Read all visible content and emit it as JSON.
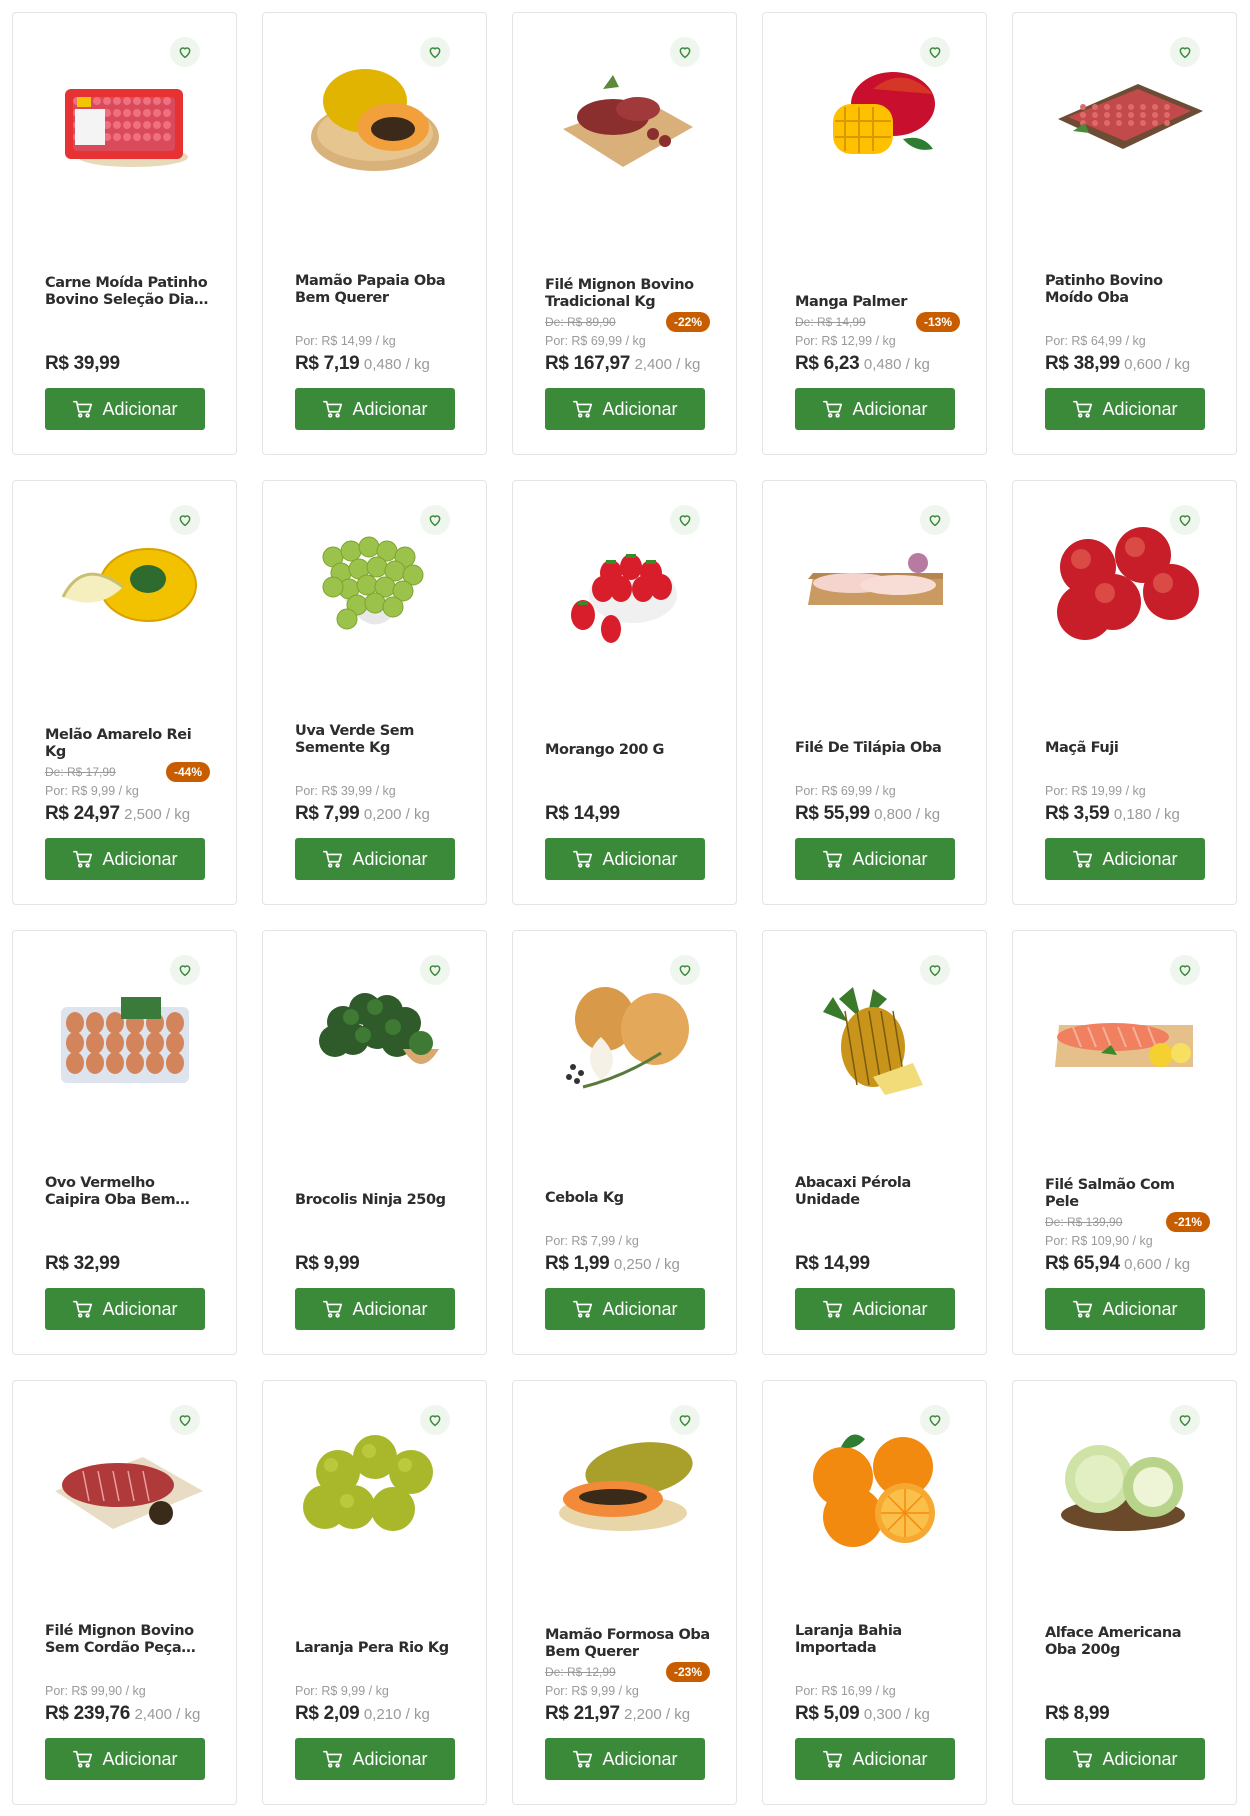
{
  "colors": {
    "button": "#3b8a3a",
    "badge": "#c85d00",
    "fav_bg": "#eef6ee",
    "heart": "#3b8a3a"
  },
  "add_label": "Adicionar",
  "products": [
    {
      "name": "Carne Moída Patinho Bovino Seleção Dia A...",
      "old": "",
      "badge": "",
      "por": "",
      "price": "R$ 39,99",
      "unit": "",
      "img": "ground-beef-tray-image"
    },
    {
      "name": "Mamão Papaia Oba Bem Querer",
      "old": "",
      "badge": "",
      "por": "Por: R$ 14,99 / kg",
      "price": "R$ 7,19",
      "unit": "0,480 / kg",
      "img": "papaya-image"
    },
    {
      "name": "Filé Mignon Bovino Tradicional Kg",
      "old": "De: R$ 89,90",
      "badge": "-22%",
      "por": "Por: R$ 69,99 / kg",
      "price": "R$ 167,97",
      "unit": "2,400 / kg",
      "img": "filet-mignon-image"
    },
    {
      "name": "Manga Palmer",
      "old": "De: R$ 14,99",
      "badge": "-13%",
      "por": "Por: R$ 12,99 / kg",
      "price": "R$ 6,23",
      "unit": "0,480 / kg",
      "img": "mango-image"
    },
    {
      "name": "Patinho Bovino Moído Oba",
      "old": "",
      "badge": "",
      "por": "Por: R$ 64,99 / kg",
      "price": "R$ 38,99",
      "unit": "0,600 / kg",
      "img": "ground-beef-board-image"
    },
    {
      "name": "Melão Amarelo Rei Kg",
      "old": "De: R$ 17,99",
      "badge": "-44%",
      "por": "Por: R$ 9,99 / kg",
      "price": "R$ 24,97",
      "unit": "2,500 / kg",
      "img": "melon-image"
    },
    {
      "name": "Uva Verde Sem Semente Kg",
      "old": "",
      "badge": "",
      "por": "Por: R$ 39,99 / kg",
      "price": "R$ 7,99",
      "unit": "0,200 / kg",
      "img": "green-grapes-image"
    },
    {
      "name": "Morango 200 G",
      "old": "",
      "badge": "",
      "por": "",
      "price": "R$ 14,99",
      "unit": "",
      "img": "strawberries-image"
    },
    {
      "name": "Filé De Tilápia Oba",
      "old": "",
      "badge": "",
      "por": "Por: R$ 69,99 / kg",
      "price": "R$ 55,99",
      "unit": "0,800 / kg",
      "img": "tilapia-image"
    },
    {
      "name": "Maçã Fuji",
      "old": "",
      "badge": "",
      "por": "Por: R$ 19,99 / kg",
      "price": "R$ 3,59",
      "unit": "0,180 / kg",
      "img": "apples-image"
    },
    {
      "name": "Ovo Vermelho Caipira Oba Bem Querer Com...",
      "old": "",
      "badge": "",
      "por": "",
      "price": "R$ 32,99",
      "unit": "",
      "img": "eggs-image"
    },
    {
      "name": "Brocolis Ninja 250g",
      "old": "",
      "badge": "",
      "por": "",
      "price": "R$ 9,99",
      "unit": "",
      "img": "broccoli-image"
    },
    {
      "name": "Cebola Kg",
      "old": "",
      "badge": "",
      "por": "Por: R$ 7,99 / kg",
      "price": "R$ 1,99",
      "unit": "0,250 / kg",
      "img": "onions-image"
    },
    {
      "name": "Abacaxi Pérola Unidade",
      "old": "",
      "badge": "",
      "por": "",
      "price": "R$ 14,99",
      "unit": "",
      "img": "pineapple-image"
    },
    {
      "name": "Filé Salmão Com Pele",
      "old": "De: R$ 139,90",
      "badge": "-21%",
      "por": "Por: R$ 109,90 / kg",
      "price": "R$ 65,94",
      "unit": "0,600 / kg",
      "img": "salmon-image"
    },
    {
      "name": "Filé Mignon Bovino Sem Cordão Peça A...",
      "old": "",
      "badge": "",
      "por": "Por: R$ 99,90 / kg",
      "price": "R$ 239,76",
      "unit": "2,400 / kg",
      "img": "filet-mignon-piece-image"
    },
    {
      "name": "Laranja Pera Rio Kg",
      "old": "",
      "badge": "",
      "por": "Por: R$ 9,99 / kg",
      "price": "R$ 2,09",
      "unit": "0,210 / kg",
      "img": "green-oranges-image"
    },
    {
      "name": "Mamão Formosa Oba Bem Querer",
      "old": "De: R$ 12,99",
      "badge": "-23%",
      "por": "Por: R$ 9,99 / kg",
      "price": "R$ 21,97",
      "unit": "2,200 / kg",
      "img": "formosa-papaya-image"
    },
    {
      "name": "Laranja Bahia Importada",
      "old": "",
      "badge": "",
      "por": "Por: R$ 16,99 / kg",
      "price": "R$ 5,09",
      "unit": "0,300 / kg",
      "img": "oranges-image"
    },
    {
      "name": "Alface Americana Oba 200g",
      "old": "",
      "badge": "",
      "por": "",
      "price": "R$ 8,99",
      "unit": "",
      "img": "lettuce-image"
    }
  ]
}
